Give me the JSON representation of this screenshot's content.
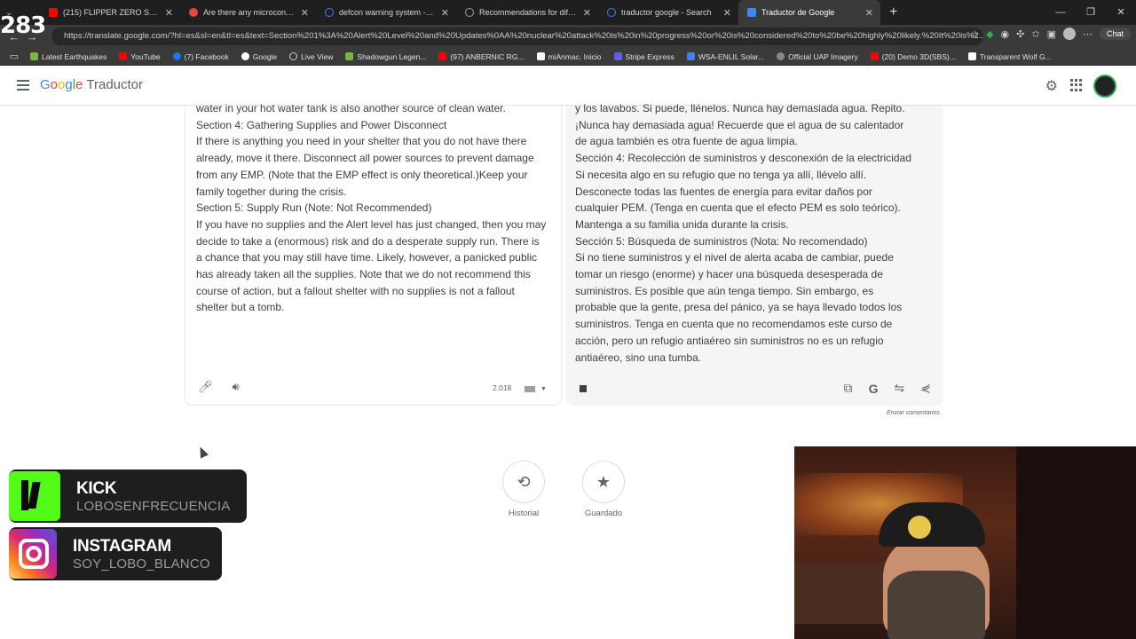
{
  "browser": {
    "tabs": [
      {
        "title": "(215) FLIPPER ZERO SEMAFORO -",
        "color": "#ff0000",
        "active": false
      },
      {
        "title": "Are there any microcontrollers wit",
        "color": "#e8453c",
        "active": false
      },
      {
        "title": "defcon warning system - Search",
        "color": "#3b82f6",
        "active": false
      },
      {
        "title": "Recommendations for different D",
        "color": "#9aa0a6",
        "active": false
      },
      {
        "title": "traductor google - Search",
        "color": "#3b82f6",
        "active": false
      },
      {
        "title": "Traductor de Google",
        "color": "#4285f4",
        "active": true
      }
    ],
    "url": "https://translate.google.com/?hl=es&sl=en&tl=es&text=Section%201%3A%20Alert%20Level%20and%20Updates%0AA%20nuclear%20attack%20is%20in%20progress%20or%20is%20considered%20to%20be%20highly%20likely.%20It%20is%2...",
    "chat_label": "Chat",
    "overlay_counter": "283",
    "bookmarks": [
      {
        "label": "Latest Earthquakes",
        "color": "#7cb342"
      },
      {
        "label": "YouTube",
        "color": "#ff0000"
      },
      {
        "label": "(7) Facebook",
        "color": "#1877f2"
      },
      {
        "label": "Google",
        "color": "#ffffff"
      },
      {
        "label": "Live View",
        "color": "#cccccc"
      },
      {
        "label": "Shadowgun Legen...",
        "color": "#7cb342"
      },
      {
        "label": "(97) ANBERNIC RG...",
        "color": "#ff0000"
      },
      {
        "label": "miAnmac. Inicio",
        "color": "#ffffff"
      },
      {
        "label": "Stripe Express",
        "color": "#635bff"
      },
      {
        "label": "WSA-ENLIL Solar...",
        "color": "#3b82f6"
      },
      {
        "label": "Official UAP Imagery",
        "color": "#888888"
      },
      {
        "label": "(20) Demo 3D(SBS)...",
        "color": "#ff0000"
      },
      {
        "label": "Transparent Wolf G...",
        "color": "#ffffff"
      }
    ]
  },
  "header": {
    "logo_letters": [
      "G",
      "o",
      "o",
      "g",
      "l",
      "e"
    ],
    "product": "Traductor"
  },
  "source": {
    "text": "water in your hot water tank is also another source of clean water.\nSection 4: Gathering Supplies and Power Disconnect\nIf there is anything you need in your shelter that you do not have there already, move it there. Disconnect all power sources to prevent damage from any EMP. (Note that the EMP effect is only theoretical.)Keep your family together during the crisis.\nSection 5: Supply Run (Note: Not Recommended)\nIf you have no supplies and the Alert level has just changed, then you may decide to take a (enormous) risk and do a desperate supply run. There is a chance that you may still have time. Likely, however, a panicked public has already taken all the supplies. Note that we do not recommend this course of action, but a fallout shelter with no supplies is not a fallout shelter but a tomb.",
    "char_count": "2.018"
  },
  "translation": {
    "text": "y los lavabos. Si puede, llénelos. Nunca hay demasiada agua. Repito. ¡Nunca hay demasiada agua! Recuerde que el agua de su calentador de agua también es otra fuente de agua limpia.\nSección 4: Recolección de suministros y desconexión de la electricidad\nSi necesita algo en su refugio que no tenga ya allí, llévelo allí. Desconecte todas las fuentes de energía para evitar daños por cualquier PEM. (Tenga en cuenta que el efecto PEM es solo teórico). Mantenga a su familia unida durante la crisis.\nSección 5: Búsqueda de suministros (Nota: No recomendado)\nSi no tiene suministros y el nivel de alerta acaba de cambiar, puede tomar un riesgo (enorme) y hacer una búsqueda desesperada de suministros. Es posible que aún tenga tiempo. Sin embargo, es probable que la gente, presa del pánico, ya se haya llevado todos los suministros. Tenga en cuenta que no recomendamos este curso de acción, pero un refugio antiaéreo sin suministros no es un refugio antiaéreo, sino una tumba."
  },
  "feedback_label": "Enviar comentarios",
  "history_label": "Historial",
  "saved_label": "Guardado",
  "overlays": {
    "kick": {
      "title": "KICK",
      "handle": "LOBOSENFRECUENCIA"
    },
    "instagram": {
      "title": "INSTAGRAM",
      "handle": "SOY_LOBO_BLANCO"
    }
  }
}
